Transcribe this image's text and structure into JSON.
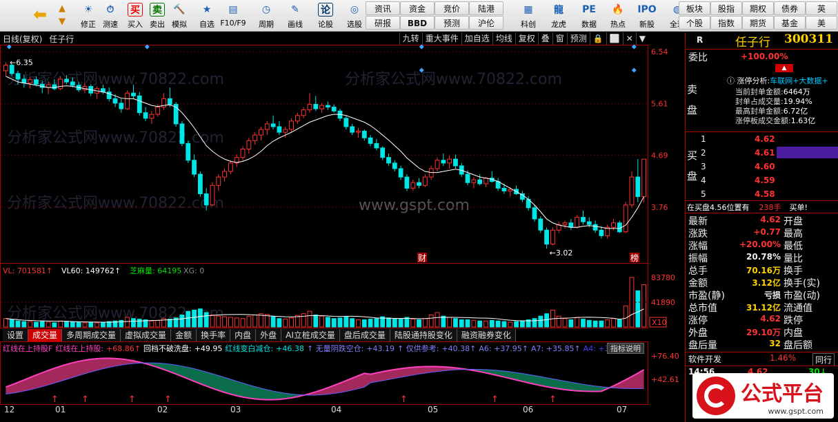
{
  "toolbar": {
    "buttons": [
      {
        "label": "",
        "icon": "back-arrow-icon",
        "x": 40
      },
      {
        "label": "修正",
        "icon": "fix-icon",
        "x": 108
      },
      {
        "label": "测速",
        "icon": "speed-test-icon",
        "x": 140
      },
      {
        "label": "买入",
        "icon_text": "买",
        "color": "#e00",
        "x": 176
      },
      {
        "label": "卖出",
        "icon_text": "卖",
        "color": "#070",
        "x": 208
      },
      {
        "label": "模拟",
        "icon": "hammer-icon",
        "x": 240
      },
      {
        "label": "自选",
        "icon": "star-icon",
        "x": 280
      },
      {
        "label": "F10/F9",
        "icon": "f10-icon",
        "x": 318
      },
      {
        "label": "周期",
        "icon": "clock-icon",
        "x": 366
      },
      {
        "label": "画线",
        "icon": "pen-icon",
        "x": 408
      },
      {
        "label": "论股",
        "icon_text": "论",
        "color": "#036",
        "x": 452
      },
      {
        "label": "选股",
        "icon": "select-stock-icon",
        "x": 494
      },
      {
        "label": "科创",
        "icon": "star-market-icon",
        "x": 746
      },
      {
        "label": "龙虎",
        "icon": "dragon-tiger-icon",
        "x": 790
      },
      {
        "label": "数据",
        "icon": "data-icon",
        "x": 834
      },
      {
        "label": "热点",
        "icon": "hot-icon",
        "x": 876
      },
      {
        "label": "新股",
        "icon": "ipo-icon",
        "x": 918
      },
      {
        "label": "全球",
        "icon": "globe-icon",
        "x": 962
      }
    ],
    "grid": [
      [
        "资讯",
        "资金",
        "竞价",
        "陆港"
      ],
      [
        "研报",
        "BBD",
        "预测",
        "沪伦"
      ]
    ],
    "grid2": [
      [
        "板块",
        "股指",
        "期权",
        "债券",
        "英"
      ],
      [
        "个股",
        "指数",
        "期货",
        "基金",
        "美"
      ]
    ]
  },
  "titlebar": {
    "period": "日线(复权)",
    "name": "任子行",
    "tools": [
      "九转",
      "重大事件",
      "加自选",
      "均线",
      "复权",
      "叠",
      "窗",
      "预测",
      "🔒",
      "⬜",
      "✕",
      "▼"
    ]
  },
  "price_axis": [
    "6.54",
    "5.61",
    "4.69",
    "3.76"
  ],
  "annotations": {
    "high": "6.35",
    "low": "3.02",
    "cai": "财",
    "bang": "榜"
  },
  "volume": {
    "legend": [
      {
        "text": "VL: 701581↑",
        "color": "#ff3232"
      },
      {
        "text": "VL60: 149762↑",
        "color": "#fff"
      },
      {
        "text": "芝麻量: 64195",
        "color": "#00e600"
      },
      {
        "text": "XG: 0",
        "color": "#888"
      }
    ],
    "axis": [
      "83780",
      "41890"
    ],
    "unit": "X10"
  },
  "tabs": [
    "设置",
    "成交量",
    "多周期成交量",
    "虚拟成交量",
    "金额",
    "换手率",
    "内盘",
    "外盘",
    "AI立桩成交量",
    "盘后成交量",
    "陆股通持股变化",
    "融资融券变化"
  ],
  "active_tab": 1,
  "indicator": {
    "legend": [
      {
        "text": "红线在上持股F",
        "color": "#ff40c0"
      },
      {
        "text": "红线在上持股:",
        "color": "#ff40c0"
      },
      {
        "text": "+68.86↑",
        "color": "#ff3232"
      },
      {
        "text": "回档不破洗盘:",
        "color": "#fff"
      },
      {
        "text": "+49.95",
        "color": "#fff"
      },
      {
        "text": "红线变白减仓:",
        "color": "#00e6e6"
      },
      {
        "text": "+46.38",
        "color": "#00e6e6"
      },
      {
        "text": "↑ 无量阴跌空仓:",
        "color": "#8080ff"
      },
      {
        "text": "+43.19",
        "color": "#8080ff"
      },
      {
        "text": "↑ 仅供参考:",
        "color": "#8080ff"
      },
      {
        "text": "+40.38↑",
        "color": "#8080ff"
      },
      {
        "text": "A6: +37.95↑",
        "color": "#8080ff"
      },
      {
        "text": "A7: +35.85↑",
        "color": "#8080ff"
      },
      {
        "text": "A4: +36",
        "color": "#4040ff"
      }
    ],
    "btn": "指标说明",
    "axis": [
      "+76.40",
      "+42.61"
    ]
  },
  "xaxis": [
    {
      "label": "12",
      "x": 6
    },
    {
      "label": "01",
      "x": 80
    },
    {
      "label": "02",
      "x": 228
    },
    {
      "label": "03",
      "x": 334
    },
    {
      "label": "04",
      "x": 480
    },
    {
      "label": "05",
      "x": 620
    },
    {
      "label": "06",
      "x": 758
    },
    {
      "label": "07",
      "x": 894
    }
  ],
  "watermark": "分析家公式网www.70822.com",
  "gspt": "www.gspt.com",
  "right": {
    "code_letter": "R",
    "name": "任子行",
    "code": "300311",
    "weibi_label": "委比",
    "weibi_val": "+100.00%",
    "zt_title": "涨停分析:",
    "zt_link": "车联网+大数据+",
    "zt_rows": [
      {
        "k": "当前封单金额:",
        "v": "6464万"
      },
      {
        "k": "封单占成交量:",
        "v": "19.94%"
      },
      {
        "k": "最高封单金额:",
        "v": "6.72亿"
      },
      {
        "k": "涨停板成交金额:",
        "v": "1.63亿"
      }
    ],
    "sell_label": "卖盘",
    "buy_label": "买盘",
    "bids": [
      {
        "n": "1",
        "p": "4.62"
      },
      {
        "n": "2",
        "p": "4.61"
      },
      {
        "n": "3",
        "p": "4.60"
      },
      {
        "n": "4",
        "p": "4.59"
      },
      {
        "n": "5",
        "p": "4.58"
      }
    ],
    "inbuy": "在买盘4.56位置有",
    "inbuy_qty": "238手",
    "inbuy_tag": "买单!",
    "stats": [
      {
        "k1": "最新",
        "v1": "4.62",
        "c1": "red",
        "k2": "开盘",
        "v2": ""
      },
      {
        "k1": "涨跌",
        "v1": "+0.77",
        "c1": "red",
        "k2": "最高",
        "v2": ""
      },
      {
        "k1": "涨幅",
        "v1": "+20.00%",
        "c1": "red",
        "k2": "最低",
        "v2": ""
      },
      {
        "k1": "振幅",
        "v1": "20.78%",
        "c1": "white",
        "k2": "量比",
        "v2": ""
      },
      {
        "k1": "总手",
        "v1": "70.16万",
        "c1": "yellow",
        "k2": "换手",
        "v2": ""
      },
      {
        "k1": "金额",
        "v1": "3.12亿",
        "c1": "yellow",
        "k2": "换手(实)",
        "v2": ""
      },
      {
        "k1": "市盈(静)",
        "v1": "亏损",
        "c1": "white",
        "k2": "市盈(动)",
        "v2": ""
      },
      {
        "k1": "总市值",
        "v1": "31.12亿",
        "c1": "yellow",
        "k2": "流通值",
        "v2": ""
      },
      {
        "k1": "涨停",
        "v1": "4.62",
        "c1": "red",
        "k2": "跌停",
        "v2": ""
      },
      {
        "k1": "外盘",
        "v1": "29.10万",
        "c1": "red",
        "k2": "内盘",
        "v2": ""
      },
      {
        "k1": "盘后量",
        "v1": "32",
        "c1": "yellow",
        "k2": "盘后额",
        "v2": ""
      }
    ],
    "sector": "软件开发",
    "sector_pct": "1.46%",
    "sector_btn": "同行",
    "tick_time": "14:56",
    "tick_price": "4.62",
    "tick_vol": "30"
  },
  "logo": {
    "text": "公式平台",
    "url": "www.gspt.com"
  },
  "chart_data": {
    "type": "candlestick",
    "candles": [
      [
        6.2,
        6.35,
        6.1,
        6.3
      ],
      [
        6.3,
        6.32,
        6.1,
        6.15
      ],
      [
        6.15,
        6.2,
        5.95,
        6.05
      ],
      [
        6.05,
        6.12,
        5.9,
        5.98
      ],
      [
        5.98,
        6.08,
        5.88,
        6.04
      ],
      [
        6.04,
        6.1,
        5.92,
        5.96
      ],
      [
        5.96,
        6.02,
        5.8,
        5.9
      ],
      [
        5.9,
        6.0,
        5.78,
        5.95
      ],
      [
        5.95,
        6.05,
        5.85,
        5.88
      ],
      [
        5.88,
        6.1,
        5.85,
        6.05
      ],
      [
        6.05,
        6.12,
        5.96,
        6.0
      ],
      [
        6.0,
        6.08,
        5.9,
        5.94
      ],
      [
        5.94,
        6.0,
        5.82,
        5.86
      ],
      [
        5.86,
        5.98,
        5.8,
        5.92
      ],
      [
        5.92,
        5.96,
        5.75,
        5.8
      ],
      [
        5.8,
        5.92,
        5.7,
        5.88
      ],
      [
        5.88,
        5.95,
        5.78,
        5.82
      ],
      [
        5.82,
        5.9,
        5.65,
        5.7
      ],
      [
        5.7,
        5.78,
        5.55,
        5.62
      ],
      [
        5.62,
        5.7,
        5.45,
        5.52
      ],
      [
        5.52,
        5.85,
        5.5,
        5.8
      ],
      [
        5.8,
        5.95,
        5.7,
        5.75
      ],
      [
        5.75,
        5.82,
        5.4,
        5.45
      ],
      [
        5.45,
        5.55,
        5.3,
        5.35
      ],
      [
        5.35,
        5.48,
        5.25,
        5.42
      ],
      [
        5.42,
        5.6,
        5.38,
        5.55
      ],
      [
        5.55,
        5.8,
        5.5,
        5.7
      ],
      [
        5.7,
        5.9,
        5.55,
        5.6
      ],
      [
        5.6,
        5.64,
        5.2,
        5.25
      ],
      [
        5.25,
        5.3,
        4.85,
        4.9
      ],
      [
        4.9,
        4.95,
        4.55,
        4.6
      ],
      [
        4.6,
        4.7,
        4.3,
        4.35
      ],
      [
        4.35,
        4.4,
        3.95,
        4.0
      ],
      [
        4.0,
        4.1,
        3.7,
        3.8
      ],
      [
        3.8,
        4.2,
        3.78,
        4.15
      ],
      [
        4.15,
        4.35,
        4.05,
        4.3
      ],
      [
        4.3,
        4.45,
        4.22,
        4.4
      ],
      [
        4.4,
        4.6,
        4.35,
        4.55
      ],
      [
        4.55,
        4.7,
        4.48,
        4.65
      ],
      [
        4.65,
        4.85,
        4.58,
        4.8
      ],
      [
        4.8,
        5.0,
        4.72,
        4.95
      ],
      [
        4.95,
        5.1,
        4.88,
        5.05
      ],
      [
        5.05,
        5.2,
        4.95,
        5.15
      ],
      [
        5.15,
        5.3,
        5.05,
        5.25
      ],
      [
        5.25,
        5.4,
        5.15,
        5.2
      ],
      [
        5.2,
        5.3,
        5.05,
        5.1
      ],
      [
        5.1,
        5.2,
        5.0,
        5.15
      ],
      [
        5.15,
        5.35,
        5.1,
        5.3
      ],
      [
        5.3,
        5.45,
        5.25,
        5.4
      ],
      [
        5.4,
        5.55,
        5.35,
        5.5
      ],
      [
        5.5,
        5.8,
        5.45,
        5.6
      ],
      [
        5.6,
        5.75,
        5.48,
        5.52
      ],
      [
        5.52,
        5.62,
        5.45,
        5.58
      ],
      [
        5.58,
        5.65,
        5.5,
        5.55
      ],
      [
        5.55,
        5.6,
        5.45,
        5.48
      ],
      [
        5.48,
        5.52,
        5.3,
        5.35
      ],
      [
        5.35,
        5.4,
        5.15,
        5.2
      ],
      [
        5.2,
        5.25,
        5.05,
        5.1
      ],
      [
        5.1,
        5.18,
        5.0,
        5.12
      ],
      [
        5.12,
        5.15,
        4.95,
        5.0
      ],
      [
        5.0,
        5.05,
        4.85,
        4.9
      ],
      [
        4.9,
        4.98,
        4.78,
        4.82
      ],
      [
        4.82,
        4.85,
        4.6,
        4.65
      ],
      [
        4.65,
        4.72,
        4.5,
        4.55
      ],
      [
        4.55,
        4.6,
        4.4,
        4.45
      ],
      [
        4.45,
        4.5,
        4.25,
        4.3
      ],
      [
        4.3,
        4.35,
        4.05,
        4.1
      ],
      [
        4.1,
        4.25,
        4.05,
        4.2
      ],
      [
        4.2,
        4.28,
        4.1,
        4.15
      ],
      [
        4.15,
        4.35,
        4.12,
        4.3
      ],
      [
        4.3,
        4.5,
        4.25,
        4.45
      ],
      [
        4.45,
        4.65,
        4.4,
        4.6
      ],
      [
        4.6,
        4.72,
        4.5,
        4.55
      ],
      [
        4.55,
        4.68,
        4.45,
        4.62
      ],
      [
        4.62,
        4.7,
        4.45,
        4.5
      ],
      [
        4.5,
        4.55,
        4.3,
        4.35
      ],
      [
        4.35,
        4.42,
        4.15,
        4.2
      ],
      [
        4.2,
        4.3,
        4.1,
        4.25
      ],
      [
        4.25,
        4.35,
        4.15,
        4.18
      ],
      [
        4.18,
        4.3,
        4.12,
        4.28
      ],
      [
        4.28,
        4.4,
        4.2,
        4.22
      ],
      [
        4.22,
        4.28,
        4.05,
        4.1
      ],
      [
        4.1,
        4.18,
        4.0,
        4.05
      ],
      [
        4.05,
        4.12,
        3.95,
        4.08
      ],
      [
        4.08,
        4.15,
        3.98,
        4.0
      ],
      [
        4.0,
        4.05,
        3.85,
        3.9
      ],
      [
        3.9,
        3.96,
        3.7,
        3.75
      ],
      [
        3.75,
        3.8,
        3.5,
        3.55
      ],
      [
        3.55,
        3.6,
        3.3,
        3.35
      ],
      [
        3.35,
        3.4,
        3.02,
        3.1
      ],
      [
        3.1,
        3.4,
        3.08,
        3.35
      ],
      [
        3.35,
        3.5,
        3.3,
        3.45
      ],
      [
        3.45,
        3.52,
        3.38,
        3.48
      ],
      [
        3.48,
        3.55,
        3.35,
        3.4
      ],
      [
        3.4,
        3.62,
        3.38,
        3.58
      ],
      [
        3.58,
        3.7,
        3.45,
        3.5
      ],
      [
        3.5,
        3.58,
        3.4,
        3.45
      ],
      [
        3.45,
        3.52,
        3.3,
        3.35
      ],
      [
        3.35,
        3.42,
        3.2,
        3.25
      ],
      [
        3.25,
        3.45,
        3.2,
        3.4
      ],
      [
        3.4,
        3.55,
        3.35,
        3.48
      ],
      [
        3.48,
        3.52,
        3.3,
        3.32
      ],
      [
        3.32,
        3.85,
        3.3,
        3.8
      ],
      [
        3.8,
        4.4,
        3.75,
        4.3
      ],
      [
        4.3,
        4.62,
        3.85,
        3.95
      ],
      [
        3.95,
        4.62,
        3.85,
        4.62
      ]
    ],
    "ma_line": [
      6.1,
      6.05,
      6.0,
      5.98,
      5.96,
      5.94,
      5.92,
      5.9,
      5.9,
      5.92,
      5.93,
      5.92,
      5.9,
      5.88,
      5.86,
      5.84,
      5.82,
      5.79,
      5.75,
      5.71,
      5.7,
      5.7,
      5.66,
      5.62,
      5.58,
      5.56,
      5.58,
      5.59,
      5.55,
      5.45,
      5.32,
      5.18,
      5.02,
      4.86,
      4.76,
      4.68,
      4.62,
      4.58,
      4.56,
      4.58,
      4.62,
      4.68,
      4.76,
      4.86,
      4.94,
      5.0,
      5.05,
      5.1,
      5.16,
      5.22,
      5.28,
      5.32,
      5.36,
      5.4,
      5.42,
      5.42,
      5.4,
      5.36,
      5.32,
      5.28,
      5.22,
      5.14,
      5.05,
      4.96,
      4.86,
      4.76,
      4.64,
      4.55,
      4.46,
      4.4,
      4.38,
      4.38,
      4.4,
      4.42,
      4.44,
      4.42,
      4.38,
      4.34,
      4.3,
      4.28,
      4.26,
      4.22,
      4.16,
      4.1,
      4.04,
      3.98,
      3.9,
      3.8,
      3.68,
      3.55,
      3.48,
      3.44,
      3.42,
      3.4,
      3.4,
      3.42,
      3.43,
      3.42,
      3.4,
      3.38,
      3.38,
      3.38,
      3.44,
      3.58,
      3.75,
      3.95
    ],
    "volumes": [
      14,
      12,
      10,
      9,
      9,
      8,
      9,
      8,
      7,
      10,
      9,
      8,
      8,
      7,
      8,
      7,
      7,
      9,
      10,
      11,
      16,
      14,
      13,
      12,
      10,
      11,
      14,
      13,
      15,
      20,
      26,
      28,
      30,
      24,
      20,
      18,
      17,
      16,
      15,
      14,
      18,
      20,
      22,
      21,
      17,
      14,
      13,
      15,
      19,
      22,
      26,
      20,
      18,
      16,
      14,
      15,
      17,
      14,
      12,
      12,
      13,
      14,
      17,
      15,
      14,
      14,
      16,
      13,
      12,
      14,
      20,
      24,
      18,
      16,
      14,
      12,
      12,
      11,
      10,
      10,
      11,
      10,
      9,
      8,
      9,
      10,
      12,
      14,
      18,
      22,
      28,
      18,
      14,
      12,
      16,
      13,
      11,
      10,
      10,
      12,
      14,
      12,
      35,
      82,
      60,
      70
    ],
    "vol_axis": [
      0,
      83780
    ],
    "ylim": [
      3.02,
      6.54
    ]
  }
}
